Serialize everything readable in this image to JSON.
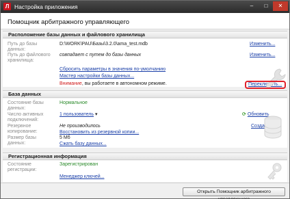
{
  "window": {
    "title": "Настройка приложения",
    "app_icon_letter": "Л",
    "minimize_glyph": "–",
    "maximize_glyph": "□",
    "close_glyph": "✕"
  },
  "header": {
    "title": "Помощник арбитражного управляющего"
  },
  "db_location": {
    "section_title": "Расположение базы данных и файлового хранилища",
    "db_path_label": "Путь до базы данных:",
    "db_path_value": "D:\\WORK\\PAU\\Базы\\3.2.0\\ama_test.mdb",
    "db_path_action": "Изменить...",
    "storage_path_label": "Путь до файлового хранилища:",
    "storage_path_value": "совпадает с путем до базы данных",
    "storage_path_action": "Изменить...",
    "reset_link": "Сбросить параметры в значения по-умолчанию",
    "wizard_link": "Мастер настройки базы данных...",
    "warning_prefix": "Внимание",
    "warning_rest": ", вы работаете в автономном режиме.",
    "switch_link": "Переключить..."
  },
  "database": {
    "section_title": "База данных",
    "state_label": "Состояние базы данных:",
    "state_value": "Нормальное",
    "connections_label": "Число активных подключений:",
    "connections_value": "1 пользователь",
    "connections_dropdown": "▾",
    "refresh_action": "Обновить",
    "backup_label": "Резервное копирование:",
    "backup_value": "Не производилось",
    "backup_restore_link": "Восстановить из резервной копии...",
    "backup_create": "Создать...",
    "size_label": "Размер базы данных:",
    "size_value": "5 Мб",
    "compress_link": "Сжать базу данных..."
  },
  "registration": {
    "section_title": "Регистрационная информация",
    "state_label": "Состояние регистрации:",
    "state_value": "Зарегистрирован",
    "key_manager_link": "Менеджер ключей..."
  },
  "footer": {
    "open_button": "Открыть Помощник арбитражного управляющего"
  },
  "icons": [
    "app-icon",
    "wrench-icon",
    "database-icon",
    "key-icon",
    "refresh-icon"
  ],
  "colors": {
    "link": "#1a3fa8",
    "ok": "#2a8a2a",
    "warning": "#d01c1c",
    "highlight": "#e0202a"
  }
}
